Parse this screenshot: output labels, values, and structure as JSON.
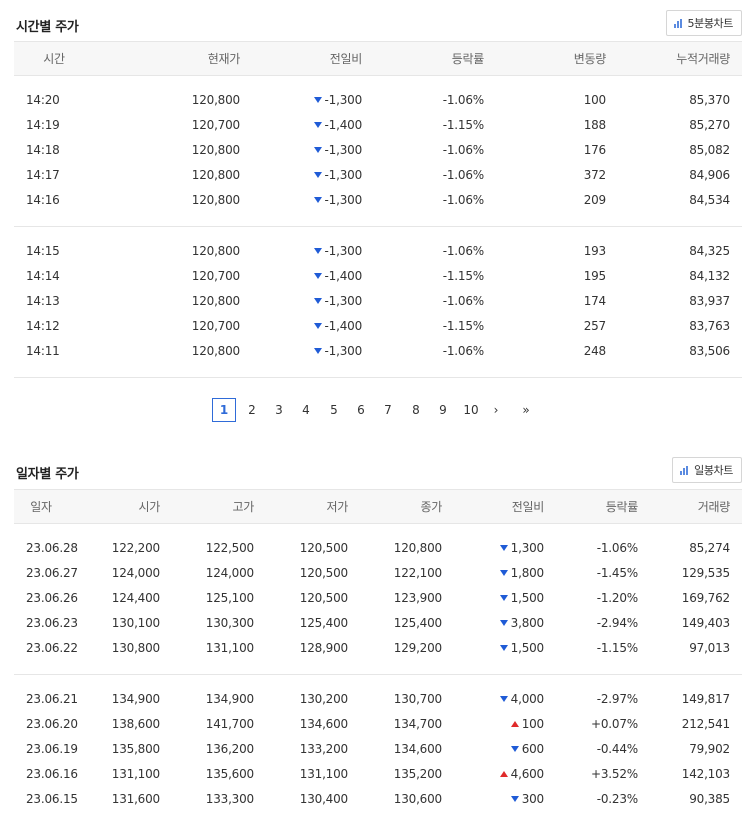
{
  "time_section": {
    "title": "시간별 주가",
    "chart_button": "5분봉차트",
    "headers": [
      "시간",
      "현재가",
      "전일비",
      "등락률",
      "변동량",
      "누적거래량"
    ],
    "groups": [
      [
        {
          "time": "14:20",
          "price": "120,800",
          "change": "-1,300",
          "dir": "down",
          "rate": "-1.06%",
          "vol": "100",
          "cum": "85,370"
        },
        {
          "time": "14:19",
          "price": "120,700",
          "change": "-1,400",
          "dir": "down",
          "rate": "-1.15%",
          "vol": "188",
          "cum": "85,270"
        },
        {
          "time": "14:18",
          "price": "120,800",
          "change": "-1,300",
          "dir": "down",
          "rate": "-1.06%",
          "vol": "176",
          "cum": "85,082"
        },
        {
          "time": "14:17",
          "price": "120,800",
          "change": "-1,300",
          "dir": "down",
          "rate": "-1.06%",
          "vol": "372",
          "cum": "84,906"
        },
        {
          "time": "14:16",
          "price": "120,800",
          "change": "-1,300",
          "dir": "down",
          "rate": "-1.06%",
          "vol": "209",
          "cum": "84,534"
        }
      ],
      [
        {
          "time": "14:15",
          "price": "120,800",
          "change": "-1,300",
          "dir": "down",
          "rate": "-1.06%",
          "vol": "193",
          "cum": "84,325"
        },
        {
          "time": "14:14",
          "price": "120,700",
          "change": "-1,400",
          "dir": "down",
          "rate": "-1.15%",
          "vol": "195",
          "cum": "84,132"
        },
        {
          "time": "14:13",
          "price": "120,800",
          "change": "-1,300",
          "dir": "down",
          "rate": "-1.06%",
          "vol": "174",
          "cum": "83,937"
        },
        {
          "time": "14:12",
          "price": "120,700",
          "change": "-1,400",
          "dir": "down",
          "rate": "-1.15%",
          "vol": "257",
          "cum": "83,763"
        },
        {
          "time": "14:11",
          "price": "120,800",
          "change": "-1,300",
          "dir": "down",
          "rate": "-1.06%",
          "vol": "248",
          "cum": "83,506"
        }
      ]
    ]
  },
  "pagination": {
    "pages": [
      "1",
      "2",
      "3",
      "4",
      "5",
      "6",
      "7",
      "8",
      "9",
      "10"
    ],
    "current": "1",
    "next": "›",
    "last": "»"
  },
  "daily_section": {
    "title": "일자별 주가",
    "chart_button": "일봉차트",
    "headers": [
      "일자",
      "시가",
      "고가",
      "저가",
      "종가",
      "전일비",
      "등락률",
      "거래량"
    ],
    "groups": [
      [
        {
          "date": "23.06.28",
          "open": "122,200",
          "high": "122,500",
          "low": "120,500",
          "close": "120,800",
          "change": "1,300",
          "dir": "down",
          "rate": "-1.06%",
          "vol": "85,274"
        },
        {
          "date": "23.06.27",
          "open": "124,000",
          "high": "124,000",
          "low": "120,500",
          "close": "122,100",
          "change": "1,800",
          "dir": "down",
          "rate": "-1.45%",
          "vol": "129,535"
        },
        {
          "date": "23.06.26",
          "open": "124,400",
          "high": "125,100",
          "low": "120,500",
          "close": "123,900",
          "change": "1,500",
          "dir": "down",
          "rate": "-1.20%",
          "vol": "169,762"
        },
        {
          "date": "23.06.23",
          "open": "130,100",
          "high": "130,300",
          "low": "125,400",
          "close": "125,400",
          "change": "3,800",
          "dir": "down",
          "rate": "-2.94%",
          "vol": "149,403"
        },
        {
          "date": "23.06.22",
          "open": "130,800",
          "high": "131,100",
          "low": "128,900",
          "close": "129,200",
          "change": "1,500",
          "dir": "down",
          "rate": "-1.15%",
          "vol": "97,013"
        }
      ],
      [
        {
          "date": "23.06.21",
          "open": "134,900",
          "high": "134,900",
          "low": "130,200",
          "close": "130,700",
          "change": "4,000",
          "dir": "down",
          "rate": "-2.97%",
          "vol": "149,817"
        },
        {
          "date": "23.06.20",
          "open": "138,600",
          "high": "141,700",
          "low": "134,600",
          "close": "134,700",
          "change": "100",
          "dir": "up",
          "rate": "+0.07%",
          "vol": "212,541"
        },
        {
          "date": "23.06.19",
          "open": "135,800",
          "high": "136,200",
          "low": "133,200",
          "close": "134,600",
          "change": "600",
          "dir": "down",
          "rate": "-0.44%",
          "vol": "79,902"
        },
        {
          "date": "23.06.16",
          "open": "131,100",
          "high": "135,600",
          "low": "131,100",
          "close": "135,200",
          "change": "4,600",
          "dir": "up",
          "rate": "+3.52%",
          "vol": "142,103"
        },
        {
          "date": "23.06.15",
          "open": "131,600",
          "high": "133,300",
          "low": "130,400",
          "close": "130,600",
          "change": "300",
          "dir": "down",
          "rate": "-0.23%",
          "vol": "90,385"
        }
      ]
    ]
  },
  "colors": {
    "down": "#1f5bd6",
    "up": "#e02a2a",
    "accent": "#2f6bd8"
  }
}
